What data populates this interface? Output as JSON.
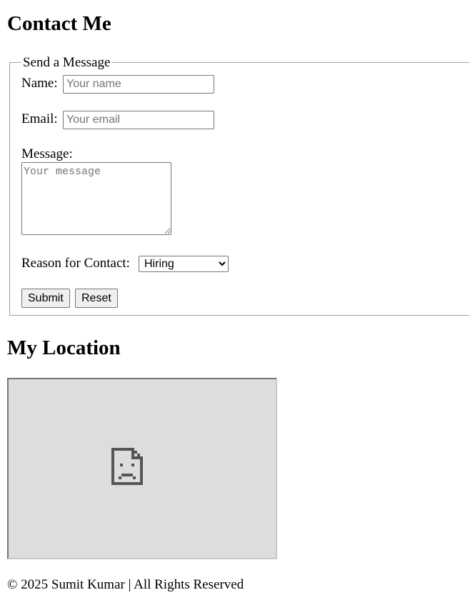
{
  "contact": {
    "heading": "Contact Me",
    "legend": "Send a Message",
    "name_label": "Name:",
    "name_placeholder": "Your name",
    "email_label": "Email:",
    "email_placeholder": "Your email",
    "message_label": "Message:",
    "message_placeholder": "Your message",
    "reason_label": "Reason for Contact:",
    "reason_selected": "Hiring",
    "submit_label": "Submit",
    "reset_label": "Reset"
  },
  "location": {
    "heading": "My Location",
    "map_icon": "broken-page-icon"
  },
  "footer": {
    "text": "© 2025 Sumit Kumar | All Rights Reserved"
  }
}
